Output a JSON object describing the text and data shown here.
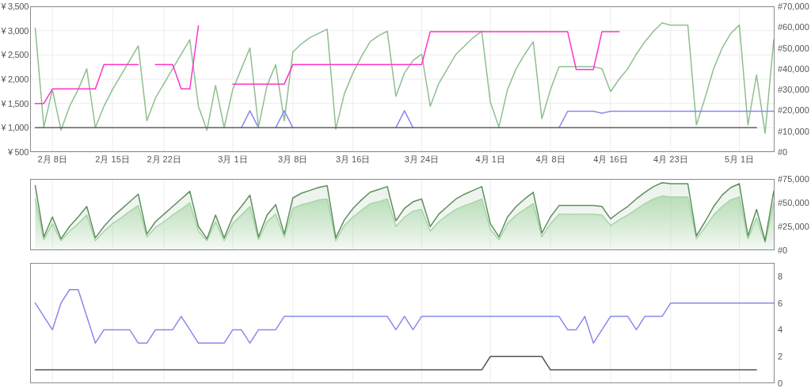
{
  "charts": [
    {
      "chart_data": {
        "type": "line",
        "grid": true,
        "categories": [
          null,
          null,
          "2月 8日",
          null,
          null,
          null,
          null,
          null,
          null,
          "2月 15日",
          null,
          null,
          null,
          null,
          null,
          "2月 22日",
          null,
          null,
          null,
          null,
          null,
          null,
          null,
          "3月 1日",
          null,
          null,
          null,
          null,
          null,
          null,
          "3月 8日",
          null,
          null,
          null,
          null,
          null,
          null,
          "3月 16日",
          null,
          null,
          null,
          null,
          null,
          null,
          null,
          "3月 24日",
          null,
          null,
          null,
          null,
          null,
          null,
          null,
          "4月 1日",
          null,
          null,
          null,
          null,
          null,
          null,
          "4月 8日",
          null,
          null,
          null,
          null,
          null,
          null,
          "4月 16日",
          null,
          null,
          null,
          null,
          null,
          null,
          "4月 23日",
          null,
          null,
          null,
          null,
          null,
          null,
          null,
          "5月 1日",
          null,
          null,
          null,
          null
        ],
        "ylim": [
          500,
          3500
        ],
        "yticks": [
          {
            "value": 500,
            "label": "¥ 500"
          },
          {
            "value": 1000,
            "label": "¥ 1,000"
          },
          {
            "value": 1500,
            "label": "¥ 1,500"
          },
          {
            "value": 2000,
            "label": "¥ 2,000"
          },
          {
            "value": 2500,
            "label": "¥ 2,500"
          },
          {
            "value": 3000,
            "label": "¥ 3,000"
          },
          {
            "value": 3500,
            "label": "¥ 3,500"
          }
        ],
        "y2lim": [
          0,
          70000
        ],
        "y2ticks": [
          {
            "value": 0,
            "label": "#0"
          },
          {
            "value": 10000,
            "label": "#10,000"
          },
          {
            "value": 20000,
            "label": "#20,000"
          },
          {
            "value": 30000,
            "label": "#30,000"
          },
          {
            "value": 40000,
            "label": "#40,000"
          },
          {
            "value": 50000,
            "label": "#50,000"
          },
          {
            "value": 60000,
            "label": "#60,000"
          },
          {
            "value": 70000,
            "label": "#70,000"
          }
        ],
        "series": [
          {
            "axis": "y2",
            "color": "#8fbf8f",
            "values": [
              59500,
              12000,
              30000,
              10500,
              22000,
              30000,
              40000,
              11700,
              22000,
              30000,
              37000,
              44000,
              51000,
              15000,
              26000,
              33000,
              40000,
              47000,
              54000,
              22000,
              10500,
              32000,
              11700,
              30000,
              40000,
              50000,
              12000,
              32000,
              42000,
              15000,
              48000,
              52000,
              55000,
              57000,
              59000,
              11000,
              28000,
              38000,
              46000,
              53000,
              56000,
              58000,
              26800,
              38000,
              44000,
              47000,
              22000,
              33000,
              40000,
              47000,
              51000,
              55000,
              58000,
              24000,
              12000,
              30000,
              40000,
              47000,
              53000,
              16000,
              30000,
              41000,
              41000,
              41000,
              41000,
              41000,
              40000,
              29000,
              35000,
              40000,
              47000,
              53000,
              58000,
              62000,
              61000,
              61000,
              61000,
              13000,
              26000,
              40000,
              50000,
              57000,
              61000,
              13000,
              37000,
              9000,
              54000
            ]
          },
          {
            "color": "#ff33cc",
            "values": [
              1500,
              1500,
              1800,
              1800,
              1800,
              1800,
              1800,
              1800,
              2300,
              2300,
              2300,
              2300,
              2300,
              null,
              2300,
              2300,
              2300,
              1800,
              1800,
              3100,
              null,
              null,
              null,
              1900,
              1900,
              1900,
              1900,
              1900,
              1900,
              1900,
              2300,
              2300,
              2300,
              2300,
              2300,
              2300,
              2300,
              2300,
              2300,
              2300,
              2300,
              2300,
              2300,
              2300,
              2300,
              2300,
              2980,
              2980,
              2980,
              2980,
              2980,
              2980,
              2980,
              2980,
              2980,
              2980,
              2980,
              2980,
              2980,
              2980,
              2980,
              2980,
              2980,
              2200,
              2200,
              2200,
              2980,
              2980,
              2980,
              null,
              null,
              null,
              null,
              null,
              null,
              null,
              null,
              null,
              null,
              null,
              null,
              null,
              null,
              null,
              null,
              null,
              null
            ]
          },
          {
            "color": "#8888ee",
            "values": [
              null,
              null,
              null,
              null,
              null,
              null,
              null,
              null,
              null,
              null,
              null,
              null,
              null,
              null,
              null,
              null,
              null,
              null,
              null,
              null,
              null,
              null,
              null,
              null,
              1000,
              1350,
              1000,
              null,
              1000,
              1350,
              1000,
              null,
              null,
              null,
              null,
              null,
              null,
              null,
              null,
              null,
              null,
              null,
              1000,
              1350,
              1000,
              null,
              null,
              null,
              null,
              null,
              null,
              null,
              null,
              null,
              null,
              null,
              null,
              null,
              null,
              null,
              null,
              1000,
              1340,
              1340,
              1340,
              1340,
              1300,
              1340,
              1340,
              1340,
              1340,
              1340,
              1340,
              1340,
              1340,
              1340,
              1340,
              1340,
              1340,
              1340,
              1340,
              1340,
              1340,
              1340,
              1340,
              1340,
              1340
            ]
          },
          {
            "color": "#606068",
            "values": [
              1000,
              1000,
              1000,
              1000,
              1000,
              1000,
              1000,
              1000,
              1000,
              1000,
              1000,
              1000,
              1000,
              1000,
              1000,
              1000,
              1000,
              1000,
              1000,
              1000,
              1000,
              1000,
              1000,
              1000,
              1000,
              1000,
              1000,
              1000,
              1000,
              1000,
              1000,
              1000,
              1000,
              1000,
              1000,
              1000,
              1000,
              1000,
              1000,
              1000,
              1000,
              1000,
              1000,
              1000,
              1000,
              1000,
              1000,
              1000,
              1000,
              1000,
              1000,
              1000,
              1000,
              1000,
              1000,
              1000,
              1000,
              1000,
              1000,
              1000,
              1000,
              1000,
              1000,
              1000,
              1000,
              1000,
              1000,
              1000,
              1000,
              1000,
              1000,
              1000,
              1000,
              1000,
              1000,
              1000,
              1000,
              1000,
              1000,
              1000,
              1000,
              1000,
              1000,
              1000,
              1000,
              null,
              null
            ]
          }
        ]
      }
    },
    {
      "chart_data": {
        "type": "area",
        "grid": true,
        "categories": [
          null,
          null,
          null,
          null,
          null,
          null,
          null,
          null,
          null,
          null,
          null,
          null,
          null,
          null,
          null,
          null,
          null,
          null,
          null,
          null,
          null,
          null,
          null,
          null,
          null,
          null,
          null,
          null,
          null,
          null,
          null,
          null,
          null,
          null,
          null,
          null,
          null,
          null,
          null,
          null,
          null,
          null,
          null,
          null,
          null,
          null,
          null,
          null,
          null,
          null,
          null,
          null,
          null,
          null,
          null,
          null,
          null,
          null,
          null,
          null,
          null,
          null,
          null,
          null,
          null,
          null,
          null,
          null,
          null,
          null,
          null,
          null,
          null,
          null,
          null,
          null,
          null,
          null,
          null,
          null,
          null,
          null,
          null,
          null,
          null,
          null,
          null
        ],
        "ylim": [
          0,
          75000
        ],
        "yticks": [
          {
            "value": 0,
            "label": "#0"
          },
          {
            "value": 25000,
            "label": "#25,000"
          },
          {
            "value": 50000,
            "label": "#50,000"
          },
          {
            "value": 75000,
            "label": "#75,000"
          }
        ],
        "series": [
          {
            "color": "#a6d6a6",
            "values": [
              54000,
              11000,
              28000,
              10000,
              20000,
              28000,
              37000,
              10000,
              20000,
              28000,
              34000,
              41000,
              47000,
              14000,
              24000,
              30000,
              37000,
              43000,
              50000,
              20000,
              10000,
              30000,
              10000,
              28000,
              37000,
              46000,
              11000,
              30000,
              38000,
              14000,
              44000,
              48000,
              50000,
              53000,
              54000,
              10000,
              26000,
              35000,
              42000,
              49000,
              51000,
              54000,
              25000,
              35000,
              41000,
              43000,
              20000,
              30000,
              37000,
              43000,
              47000,
              50000,
              54000,
              22000,
              11000,
              28000,
              37000,
              43000,
              49000,
              14000,
              28000,
              38000,
              38000,
              38000,
              38000,
              38000,
              37000,
              26000,
              32000,
              37000,
              43000,
              49000,
              54000,
              57000,
              56000,
              56000,
              56000,
              12000,
              24000,
              37000,
              46000,
              53000,
              56000,
              12000,
              34000,
              8000,
              50000
            ]
          },
          {
            "color": "#5e8f5e",
            "values": [
              68000,
              14000,
              35000,
              12000,
              25000,
              35000,
              46000,
              13000,
              25000,
              35000,
              43000,
              51000,
              59000,
              17000,
              30000,
              38000,
              46000,
              54000,
              62000,
              25000,
              12000,
              37000,
              13000,
              35000,
              46000,
              58000,
              14000,
              37000,
              48000,
              17000,
              55000,
              60000,
              63000,
              66000,
              68000,
              13000,
              32000,
              44000,
              53000,
              61000,
              64000,
              67000,
              31000,
              44000,
              51000,
              54000,
              25000,
              38000,
              46000,
              54000,
              59000,
              63000,
              67000,
              28000,
              14000,
              35000,
              46000,
              54000,
              61000,
              18000,
              35000,
              47000,
              47000,
              47000,
              47000,
              47000,
              46000,
              33000,
              40000,
              46000,
              54000,
              61000,
              67000,
              71000,
              70000,
              70000,
              70000,
              15000,
              30000,
              46000,
              58000,
              66000,
              70000,
              15000,
              43000,
              10000,
              62000
            ]
          }
        ]
      }
    },
    {
      "chart_data": {
        "type": "line",
        "grid": true,
        "categories": [
          null,
          null,
          null,
          null,
          null,
          null,
          null,
          null,
          null,
          null,
          null,
          null,
          null,
          null,
          null,
          null,
          null,
          null,
          null,
          null,
          null,
          null,
          null,
          null,
          null,
          null,
          null,
          null,
          null,
          null,
          null,
          null,
          null,
          null,
          null,
          null,
          null,
          null,
          null,
          null,
          null,
          null,
          null,
          null,
          null,
          null,
          null,
          null,
          null,
          null,
          null,
          null,
          null,
          null,
          null,
          null,
          null,
          null,
          null,
          null,
          null,
          null,
          null,
          null,
          null,
          null,
          null,
          null,
          null,
          null,
          null,
          null,
          null,
          null,
          null,
          null,
          null,
          null,
          null,
          null,
          null,
          null,
          null,
          null,
          null,
          null,
          null
        ],
        "ylim": [
          0,
          9
        ],
        "yticks": [
          {
            "value": 0,
            "label": "0"
          },
          {
            "value": 2,
            "label": "2"
          },
          {
            "value": 4,
            "label": "4"
          },
          {
            "value": 6,
            "label": "6"
          },
          {
            "value": 8,
            "label": "8"
          }
        ],
        "series": [
          {
            "color": "#8888ee",
            "values": [
              6,
              5,
              4,
              6,
              7,
              7,
              5,
              3,
              4,
              4,
              4,
              4,
              3,
              3,
              4,
              4,
              4,
              5,
              4,
              3,
              3,
              3,
              3,
              4,
              4,
              3,
              4,
              4,
              4,
              5,
              5,
              5,
              5,
              5,
              5,
              5,
              5,
              5,
              5,
              5,
              5,
              5,
              4,
              5,
              4,
              5,
              5,
              5,
              5,
              5,
              5,
              5,
              5,
              5,
              5,
              5,
              5,
              5,
              5,
              5,
              5,
              5,
              4,
              4,
              5,
              3,
              4,
              5,
              5,
              5,
              4,
              5,
              5,
              5,
              6,
              6,
              6,
              6,
              6,
              6,
              6,
              6,
              6,
              6,
              6,
              6,
              6
            ]
          },
          {
            "color": "#555555",
            "values": [
              1,
              1,
              1,
              1,
              1,
              1,
              1,
              1,
              1,
              1,
              1,
              1,
              1,
              1,
              1,
              1,
              1,
              1,
              1,
              1,
              1,
              1,
              1,
              1,
              1,
              1,
              1,
              1,
              1,
              1,
              1,
              1,
              1,
              1,
              1,
              1,
              1,
              1,
              1,
              1,
              1,
              1,
              1,
              1,
              1,
              1,
              1,
              1,
              1,
              1,
              1,
              1,
              1,
              2,
              2,
              2,
              2,
              2,
              2,
              2,
              1,
              1,
              1,
              1,
              1,
              1,
              1,
              1,
              1,
              1,
              1,
              1,
              1,
              1,
              1,
              1,
              1,
              1,
              1,
              1,
              1,
              1,
              1,
              1,
              1,
              null,
              null
            ]
          }
        ]
      }
    }
  ]
}
